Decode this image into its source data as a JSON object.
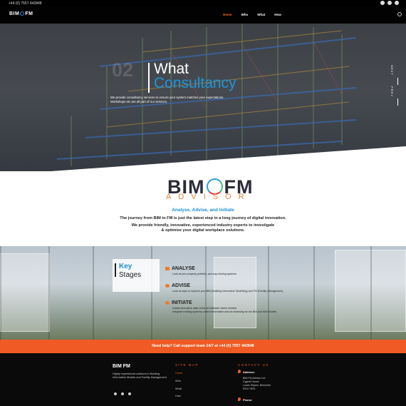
{
  "topbar": {
    "phone": "+44 (0) 7557 442848",
    "socials": [
      "facebook-icon",
      "twitter-icon",
      "instagram-icon"
    ]
  },
  "header": {
    "logo": "BIM FM",
    "nav": [
      "Home",
      "Who",
      "What",
      "How"
    ],
    "active_nav": "Home",
    "accent": "#ff6a1a"
  },
  "hero": {
    "number": "02",
    "title_line1": "What",
    "title_line2": "Consultancy",
    "paragraph": "We provide consultancy services to ensure your system matches your expectations. Workshops etc are all part of our services.",
    "side_labels": [
      "NEXT",
      "PREV"
    ]
  },
  "intro": {
    "logo_left": "BIM",
    "logo_right": "FM",
    "logo_sub": "ADVISOR",
    "subtitle": "Analyse, Advise, and Initiate",
    "line1": "The journey from BIM to FM is just the latest step in a long journey of digital innovation.",
    "line2": "We provide friendly, innovative, experienced industry experts to investigate",
    "line3": "& optimise your digital workplace solutions."
  },
  "stages": {
    "heading1": "Key",
    "heading2": "Stages",
    "items": [
      {
        "title": "ANALYSE",
        "text": "Look at your property portfolio, and any existing systems"
      },
      {
        "title": "ADVISE",
        "text": "Look at ways to improve your BIM (Building Information Modelling) and FM (Facility Management)"
      },
      {
        "title": "INITIATE",
        "text": "Initiate innovative state of the art software where needed.\nIntegrate existing systems, collect information and do cleansing for the BIM and BIM Models"
      }
    ]
  },
  "cta": {
    "text": "Need help? Call support team 24/7 at +44 (0) 7557 442848"
  },
  "footer": {
    "logo": "BIM FM",
    "description": "Highly experienced advisors in Building Information Models and Facility Management",
    "sitemap_heading": "SITE MAP",
    "links": [
      "Home",
      "Who",
      "What",
      "How"
    ],
    "contact_heading": "CONTACT US",
    "address_label": "Address:",
    "address": "BIM FM Advisor Ltd\nCygnet House\nLower Hilyam, Berkshire\nRG17 9ED",
    "phone_label": "Phone:"
  }
}
